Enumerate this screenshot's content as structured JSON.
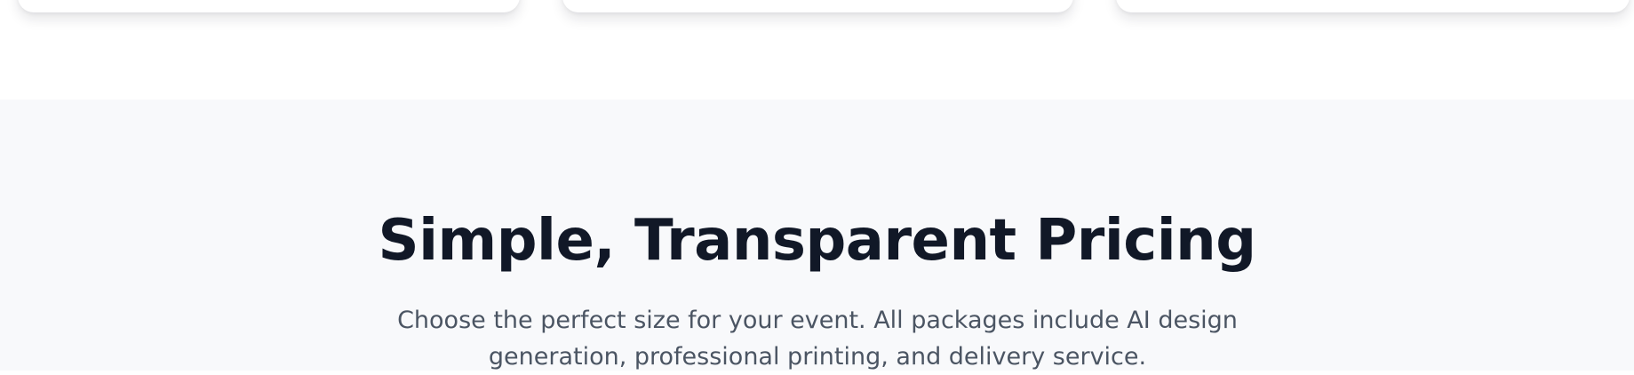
{
  "pricing": {
    "title": "Simple, Transparent Pricing",
    "subtitle": "Choose the perfect size for your event. All packages include AI design generation, professional printing, and delivery service."
  },
  "colors": {
    "section_background": "#f8f9fb",
    "title_text": "#111827",
    "subtitle_text": "#4b5563",
    "card_background": "#ffffff"
  }
}
